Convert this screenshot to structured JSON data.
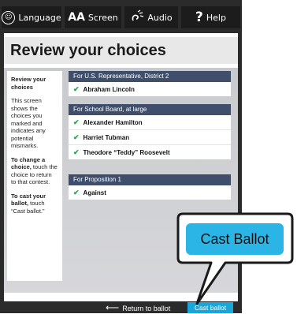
{
  "toolbar": {
    "language": {
      "label": "Language",
      "icon": "globe-icon"
    },
    "screen": {
      "label": "Screen",
      "icon_text": "AA"
    },
    "audio": {
      "label": "Audio",
      "icon": "audio-icon"
    },
    "help": {
      "label": "Help",
      "icon_text": "?"
    }
  },
  "page": {
    "title": "Review your choices"
  },
  "instructions": {
    "heading": "Review your choices",
    "body": "This screen shows the choices you marked and indicates any potential mismarks.",
    "change_bold": "To change a choice,",
    "change_rest": " touch the choice to return to that contest.",
    "cast_bold": "To cast your ballot,",
    "cast_rest": " touch “Cast ballot.”"
  },
  "contests": [
    {
      "header": "For U.S. Representative, District 2",
      "choices": [
        "Abraham Lincoln"
      ]
    },
    {
      "header": "For School Board, at large",
      "choices": [
        "Alexander Hamilton",
        "Harriet Tubman",
        "Theodore “Teddy” Roosevelt"
      ]
    },
    {
      "header": "For Proposition 1",
      "choices": [
        "Against"
      ]
    }
  ],
  "footer": {
    "return_label": "Return to ballot",
    "cast_label": "Cast ballot"
  },
  "callout": {
    "label": "Cast Ballot"
  },
  "colors": {
    "contest_header": "#3f4f6b",
    "check": "#27a34a",
    "cast_button": "#1ba6d8",
    "callout": "#2bb5e6"
  }
}
